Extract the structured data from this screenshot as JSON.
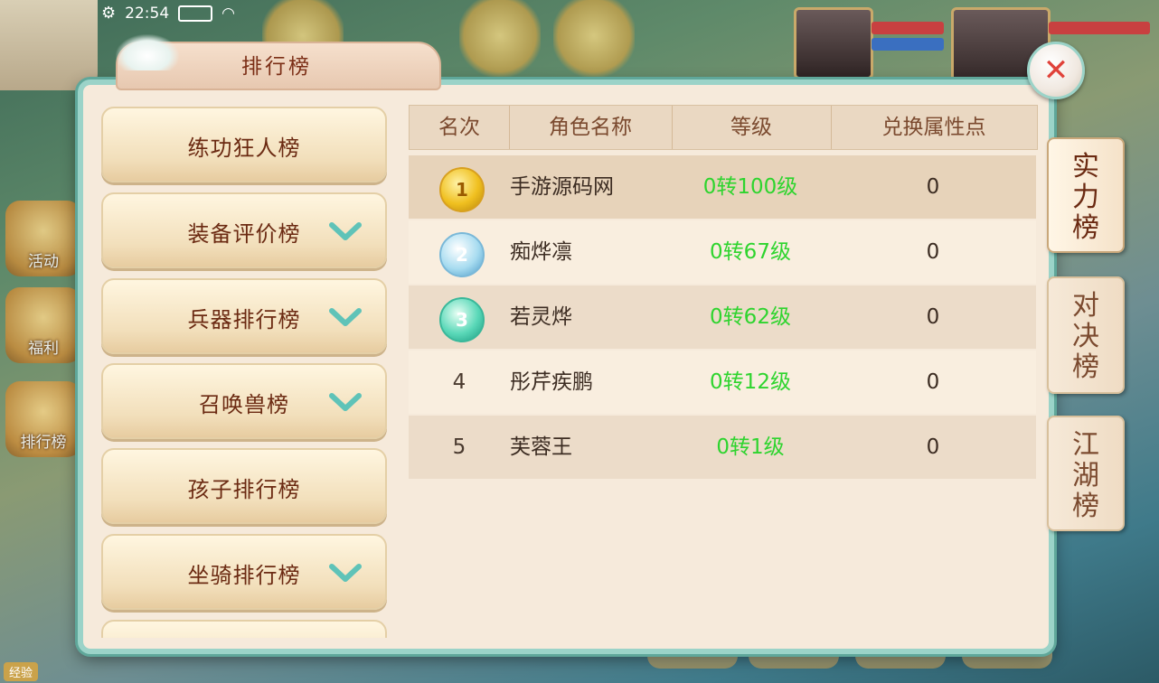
{
  "status": {
    "time": "22:54"
  },
  "background": {
    "dock_labels": [
      "活动",
      "福利",
      "排行榜"
    ],
    "exp_label": "经验"
  },
  "panel": {
    "title": "排行榜",
    "close_symbol": "✕"
  },
  "categories": [
    {
      "label": "练功狂人榜",
      "expandable": false
    },
    {
      "label": "装备评价榜",
      "expandable": true
    },
    {
      "label": "兵器排行榜",
      "expandable": true
    },
    {
      "label": "召唤兽榜",
      "expandable": true
    },
    {
      "label": "孩子排行榜",
      "expandable": false
    },
    {
      "label": "坐骑排行榜",
      "expandable": true
    },
    {
      "label": "",
      "expandable": false
    }
  ],
  "table": {
    "headers": [
      "名次",
      "角色名称",
      "等级",
      "兑换属性点"
    ],
    "rows": [
      {
        "rank": "1",
        "name": "手游源码网",
        "level": "0转100级",
        "points": "0",
        "medal": "gold"
      },
      {
        "rank": "2",
        "name": "痴烨凛",
        "level": "0转67级",
        "points": "0",
        "medal": "silver"
      },
      {
        "rank": "3",
        "name": "若灵烨",
        "level": "0转62级",
        "points": "0",
        "medal": "jade"
      },
      {
        "rank": "4",
        "name": "彤芹疾鹏",
        "level": "0转12级",
        "points": "0",
        "medal": ""
      },
      {
        "rank": "5",
        "name": "芙蓉王",
        "level": "0转1级",
        "points": "0",
        "medal": ""
      }
    ]
  },
  "side_tabs": [
    {
      "label": "实力榜",
      "active": true
    },
    {
      "label": "对决榜",
      "active": false
    },
    {
      "label": "江湖榜",
      "active": false
    }
  ],
  "colors": {
    "level_green": "#2ed42e",
    "title_brown": "#7b2e16",
    "close_red": "#e0423a",
    "panel_border": "#9bd3c8"
  }
}
